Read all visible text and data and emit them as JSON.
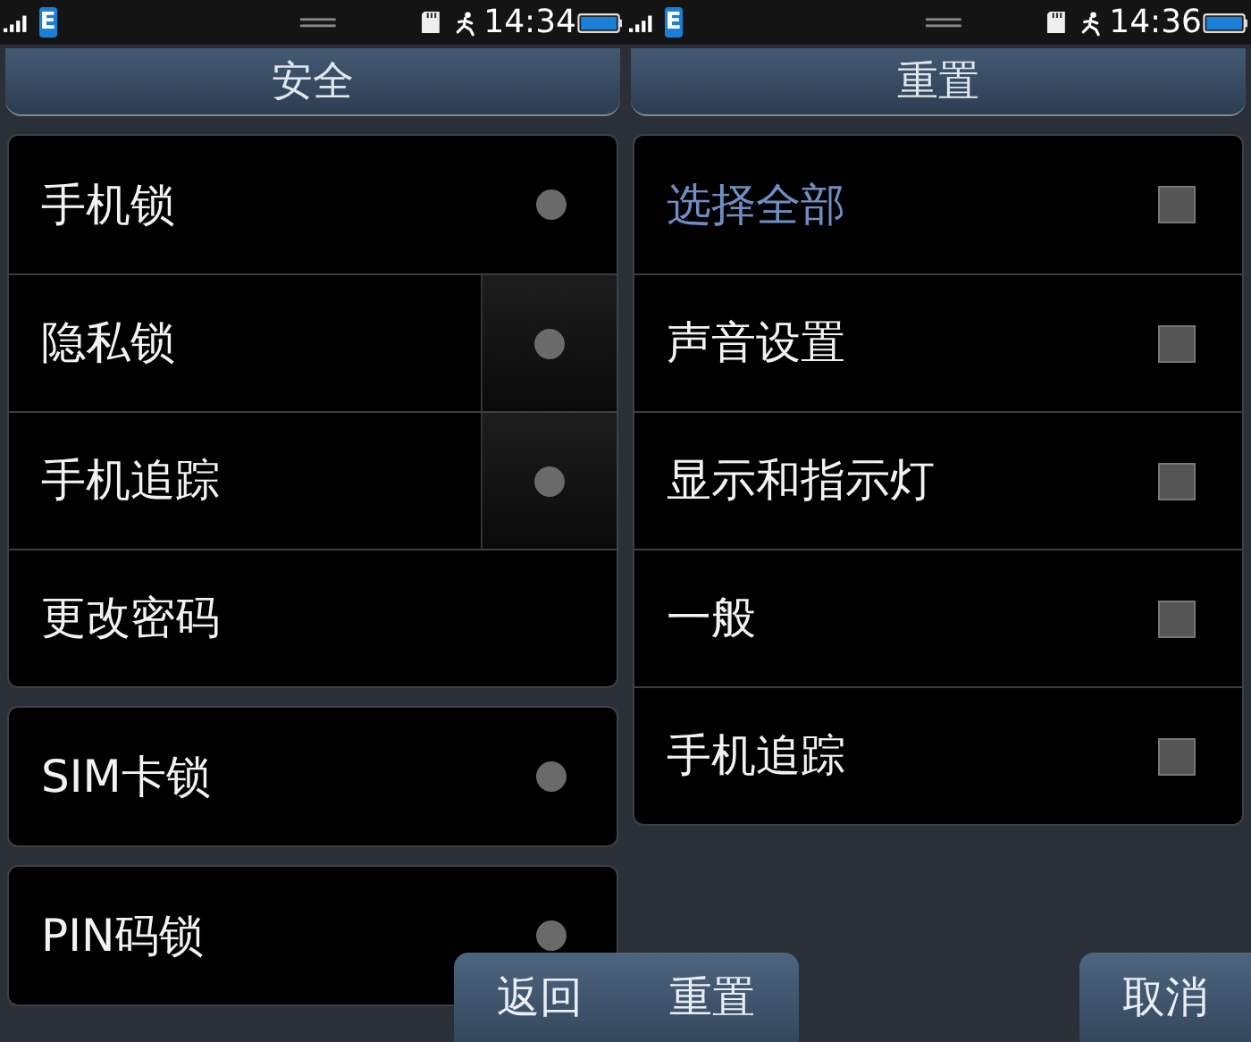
{
  "screens": [
    {
      "status_bar": {
        "network": "E",
        "time": "14:34"
      },
      "title": "安全",
      "groups": [
        {
          "items": [
            {
              "label": "手机锁",
              "kind": "toggle",
              "on": false
            },
            {
              "label": "隐私锁",
              "kind": "split-toggle",
              "on": false
            },
            {
              "label": "手机追踪",
              "kind": "split-toggle",
              "on": false
            },
            {
              "label": "更改密码",
              "kind": "link"
            }
          ]
        },
        {
          "items": [
            {
              "label": "SIM卡锁",
              "kind": "toggle",
              "on": false
            }
          ]
        },
        {
          "items": [
            {
              "label": "PIN码锁",
              "kind": "toggle",
              "on": false
            }
          ]
        }
      ],
      "buttons": [
        {
          "label": "返回"
        }
      ]
    },
    {
      "status_bar": {
        "network": "E",
        "time": "14:36"
      },
      "title": "重置",
      "groups": [
        {
          "items": [
            {
              "label": "选择全部",
              "kind": "select-all",
              "checked": false
            },
            {
              "label": "声音设置",
              "kind": "check",
              "checked": false
            },
            {
              "label": "显示和指示灯",
              "kind": "check",
              "checked": false
            },
            {
              "label": "一般",
              "kind": "check",
              "checked": false
            },
            {
              "label": "手机追踪",
              "kind": "check",
              "checked": false
            }
          ]
        }
      ],
      "buttons": [
        {
          "label": "重置"
        },
        {
          "label": "取消"
        }
      ]
    }
  ]
}
